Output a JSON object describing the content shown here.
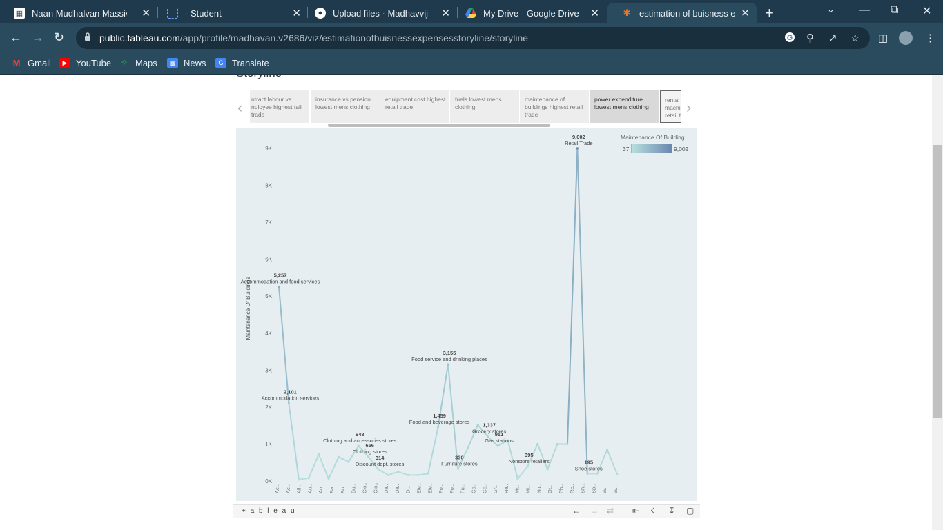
{
  "browser": {
    "tabs": [
      {
        "title": "Naan Mudhalvan Massive Up",
        "icon": "naan-mudhalvan-icon",
        "active": false
      },
      {
        "title": "- Student",
        "icon": "student-icon",
        "active": false
      },
      {
        "title": "Upload files · Madhavvijayak",
        "icon": "github-icon",
        "active": false
      },
      {
        "title": "My Drive - Google Drive",
        "icon": "google-drive-icon",
        "active": false
      },
      {
        "title": "estimation of buisness expe",
        "icon": "tableau-icon",
        "active": true
      }
    ],
    "new_tab": "+",
    "url_host": "public.tableau.com",
    "url_path": "/app/profile/madhavan.v2686/viz/estimationofbuisnessexpensesstoryline/storyline",
    "bookmarks": [
      "Gmail",
      "YouTube",
      "Maps",
      "News",
      "Translate"
    ]
  },
  "story": {
    "title": "Storyline",
    "points": [
      "ntract labour vs nployee highest tail trade",
      "insurance vs pension lowest mens clothing",
      "equipment cost highest retail trade",
      "fuels lowest mens clothing",
      "maintenance of buildings highest retail trade",
      "power expenditure lowest mens clothing",
      "rental machi retail t"
    ]
  },
  "legend": {
    "title": "Maintenance Of Building...",
    "min": "37",
    "max": "9,002"
  },
  "footer": {
    "logo": "+ a b l e a u"
  },
  "chart_data": {
    "type": "line",
    "ylabel": "Maintenance Of Buildings",
    "ylim": [
      0,
      9000
    ],
    "yticks": [
      "0K",
      "1K",
      "2K",
      "3K",
      "4K",
      "5K",
      "6K",
      "7K",
      "8K",
      "9K"
    ],
    "ytick_values": [
      0,
      1000,
      2000,
      3000,
      4000,
      5000,
      6000,
      7000,
      8000,
      9000
    ],
    "categories": [
      "Ac..",
      "Ac..",
      "All..",
      "Au..",
      "Au..",
      "Ba..",
      "Bu..",
      "Bu..",
      "Clo..",
      "Clo..",
      "De..",
      "De..",
      "Di..",
      "Ele..",
      "Ele..",
      "Fo..",
      "Fo..",
      "Fu..",
      "Ga..",
      "Ge..",
      "Gr..",
      "He..",
      "Mo..",
      "Mi..",
      "No..",
      "Ot..",
      "Ph..",
      "Re..",
      "Sh..",
      "Sp..",
      "W..",
      "W.."
    ],
    "values": [
      5257,
      2101,
      40,
      80,
      720,
      60,
      650,
      520,
      948,
      656,
      314,
      160,
      250,
      160,
      160,
      200,
      1459,
      3155,
      330,
      900,
      1520,
      1200,
      951,
      1100,
      60,
      395,
      1000,
      320,
      1000,
      1000,
      9002,
      195,
      200,
      850,
      180
    ],
    "annotations": [
      {
        "index": 0,
        "value": "5,257",
        "label": "Accommodation and food services"
      },
      {
        "index": 1,
        "value": "2,101",
        "label": "Accommodation services"
      },
      {
        "index": 8,
        "value": "948",
        "label": "Clothing and accessories stores"
      },
      {
        "index": 9,
        "value": "656",
        "label": "Clothing stores"
      },
      {
        "index": 10,
        "value": "314",
        "label": "Discount dept. stores"
      },
      {
        "index": 16,
        "value": "1,459",
        "label": "Food and beverage stores"
      },
      {
        "index": 17,
        "value": "3,155",
        "label": "Food service and drinking places"
      },
      {
        "index": 18,
        "value": "330",
        "label": "Furniture stores"
      },
      {
        "index": 22,
        "value": "951",
        "label": "Gas stations"
      },
      {
        "index": 21,
        "value": "1,337",
        "label": "Grocery stores"
      },
      {
        "index": 25,
        "value": "395",
        "label": "Nonstore retailers"
      },
      {
        "index": 30,
        "value": "9,002",
        "label": "Retail Trade"
      },
      {
        "index": 31,
        "value": "195",
        "label": "Shoe stores"
      }
    ],
    "color_min": "#b7e0de",
    "color_max": "#6a87b0",
    "background": "#e6eef1"
  }
}
